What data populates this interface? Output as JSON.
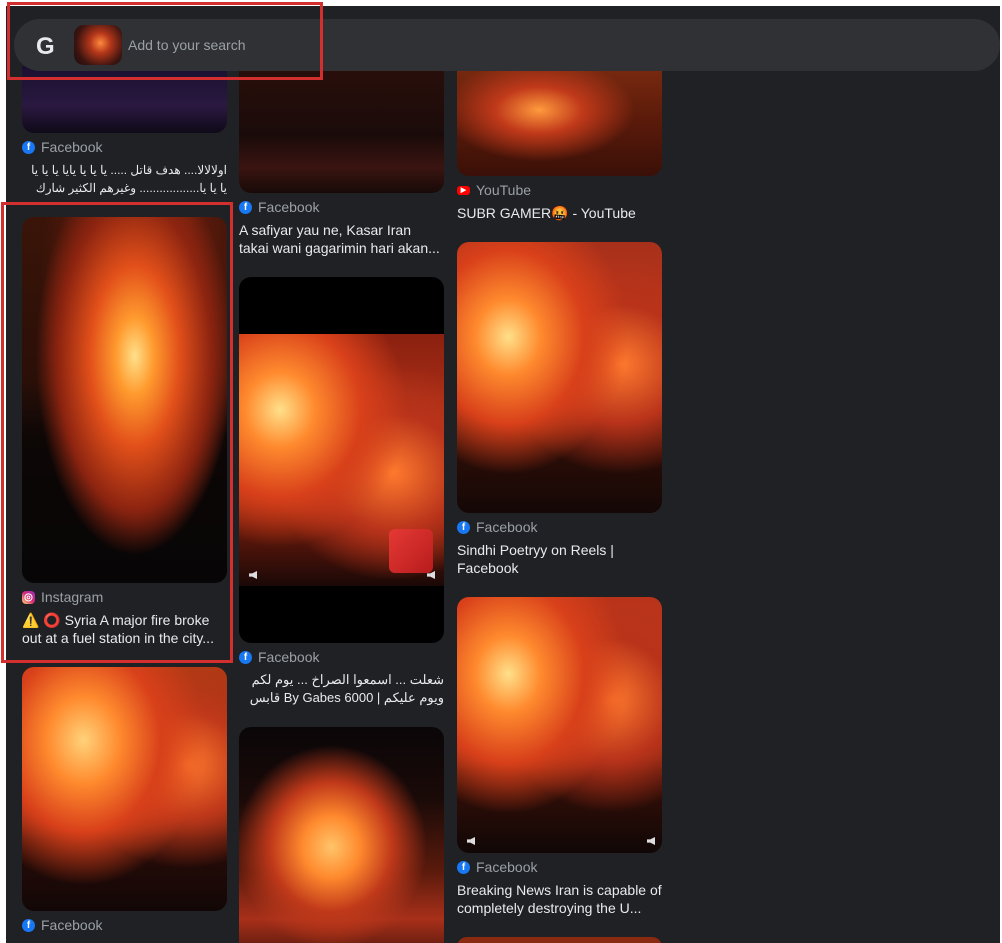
{
  "search": {
    "placeholder": "Add to your search",
    "logo": "G"
  },
  "columns": [
    [
      {
        "source": "Facebook",
        "source_icon": "facebook-icon",
        "title": "اولالالا.... هدف قاتل ..... يا يا يا يايا يا يا يا يا يا يا.................. وغيرهم الكثير شارك في ...",
        "rtl": true
      },
      {
        "source": "Instagram",
        "source_icon": "instagram-icon",
        "title": "⚠️ ⭕ Syria A major fire broke out at a fuel station in the city..."
      },
      {
        "source": "Facebook",
        "source_icon": "facebook-icon",
        "title": ""
      }
    ],
    [
      {
        "source": "Facebook",
        "source_icon": "facebook-icon",
        "title": "A safiyar yau ne, Kasar Iran takai wani gagarimin hari akan..."
      },
      {
        "source": "Facebook",
        "source_icon": "facebook-icon",
        "title": "شعلت ... اسمعوا الصراخ ... يوم لكم ويوم عليكم | By Gabes 6000 قابس |...",
        "rtl": true
      }
    ],
    [
      {
        "source": "YouTube",
        "source_icon": "youtube-icon",
        "title": "SUBR GAMER🤬 - YouTube"
      },
      {
        "source": "Facebook",
        "source_icon": "facebook-icon",
        "title": "Sindhi Poetryy on Reels | Facebook"
      },
      {
        "source": "Facebook",
        "source_icon": "facebook-icon",
        "title": "Breaking News Iran is capable of completely destroying the U..."
      }
    ]
  ],
  "colors": {
    "background": "#202124",
    "search_bg": "#303134",
    "highlight": "#d32f2f",
    "facebook": "#1877f2",
    "youtube": "#ff0000"
  }
}
